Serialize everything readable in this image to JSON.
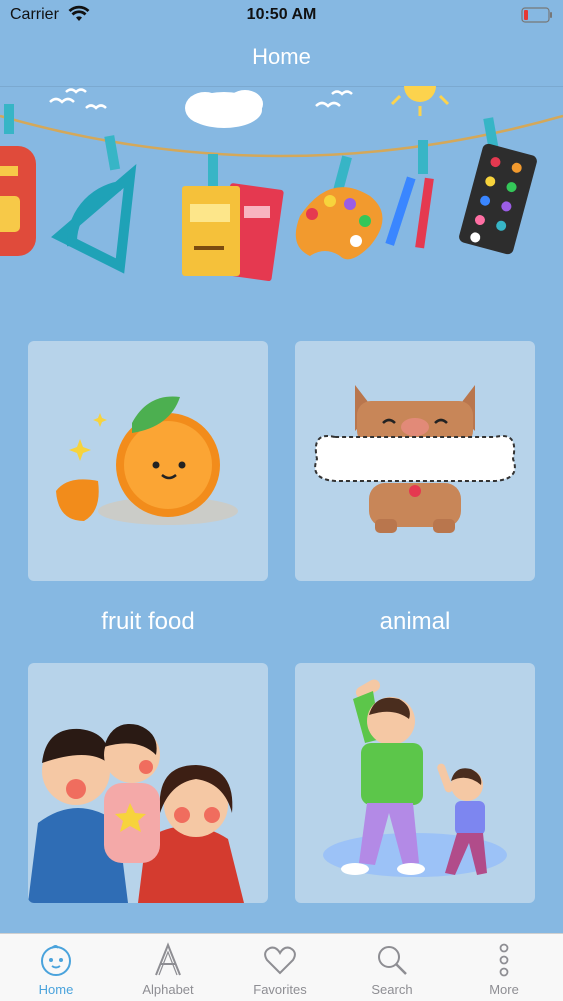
{
  "status": {
    "carrier": "Carrier",
    "time": "10:50 AM"
  },
  "nav": {
    "title": "Home"
  },
  "categories": [
    {
      "label": "fruit food",
      "icon": "orange-fruit-illustration"
    },
    {
      "label": "animal",
      "icon": "dog-with-bone-illustration"
    },
    {
      "label": "",
      "icon": "family-illustration"
    },
    {
      "label": "",
      "icon": "exercise-illustration"
    }
  ],
  "tabs": [
    {
      "label": "Home",
      "icon": "baby-face-icon",
      "active": true
    },
    {
      "label": "Alphabet",
      "icon": "letter-a-icon",
      "active": false
    },
    {
      "label": "Favorites",
      "icon": "heart-icon",
      "active": false
    },
    {
      "label": "Search",
      "icon": "magnifier-icon",
      "active": false
    },
    {
      "label": "More",
      "icon": "more-dots-icon",
      "active": false
    }
  ],
  "colors": {
    "background": "#86b8e2",
    "card": "#b7d3ea",
    "active_tab": "#4aa3dc",
    "inactive_tab": "#8e8e93"
  }
}
